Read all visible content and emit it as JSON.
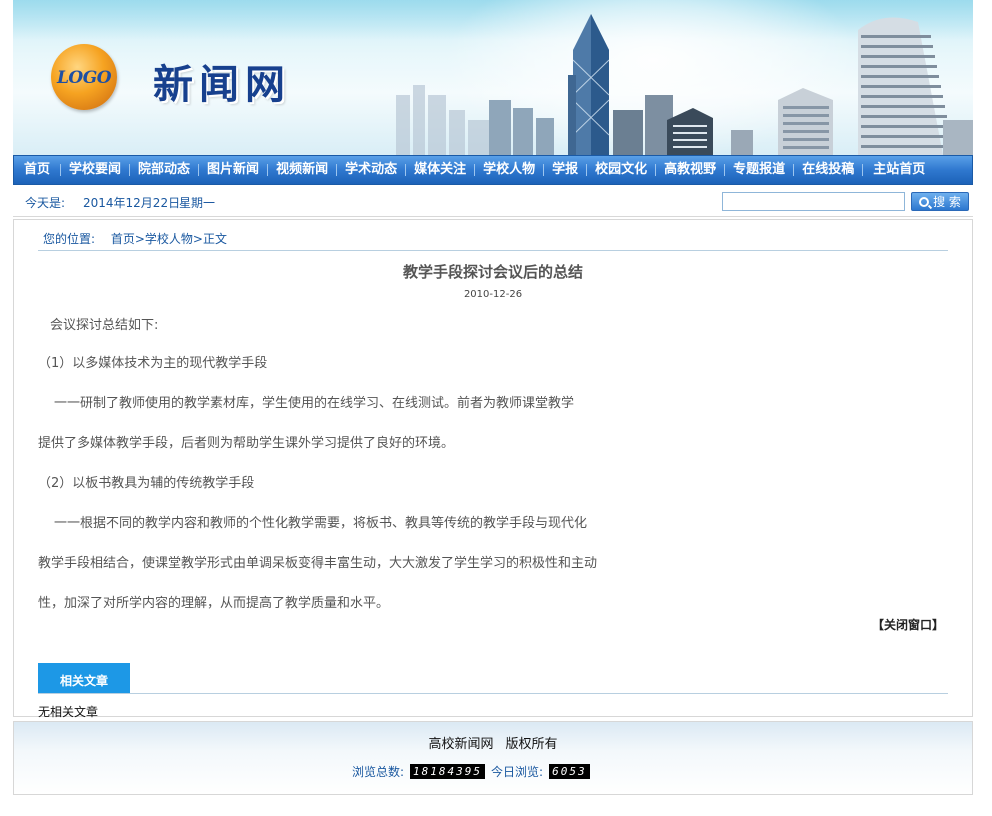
{
  "header": {
    "logo_text": "LOGO",
    "site_name": "新闻网"
  },
  "nav": {
    "items": [
      "首页",
      "学校要闻",
      "院部动态",
      "图片新闻",
      "视频新闻",
      "学术动态",
      "媒体关注",
      "学校人物",
      "学报",
      "校园文化",
      "高教视野",
      "专题报道",
      "在线投稿",
      "主站首页"
    ]
  },
  "datebar": {
    "label": "今天是:",
    "date": "2014年12月22日",
    "weekday": "星期一",
    "search_value": "",
    "search_button": "搜 索"
  },
  "breadcrumb": {
    "label": "您的位置:",
    "path": "首页>学校人物>正文"
  },
  "article": {
    "title": "教学手段探讨会议后的总结",
    "date": "2010-12-26",
    "paragraphs": [
      "会议探讨总结如下:",
      "（1）以多媒体技术为主的现代教学手段",
      "一一研制了教师使用的教学素材库，学生使用的在线学习、在线测试。前者为教师课堂教学",
      "提供了多媒体教学手段，后者则为帮助学生课外学习提供了良好的环境。",
      "（2）以板书教具为辅的传统教学手段",
      "一一根据不同的教学内容和教师的个性化教学需要，将板书、教具等传统的教学手段与现代化",
      "教学手段相结合，使课堂教学形式由单调呆板变得丰富生动，大大激发了学生学习的积极性和主动",
      "性，加深了对所学内容的理解，从而提高了教学质量和水平。"
    ],
    "close_window": "【关闭窗口】"
  },
  "related": {
    "tab_label": "相关文章",
    "empty_text": "无相关文章"
  },
  "footer": {
    "site": "高校新闻网",
    "rights": "版权所有",
    "total_label": "浏览总数:",
    "total_value": "18184395",
    "today_label": "今日浏览:",
    "today_value": "6053"
  }
}
